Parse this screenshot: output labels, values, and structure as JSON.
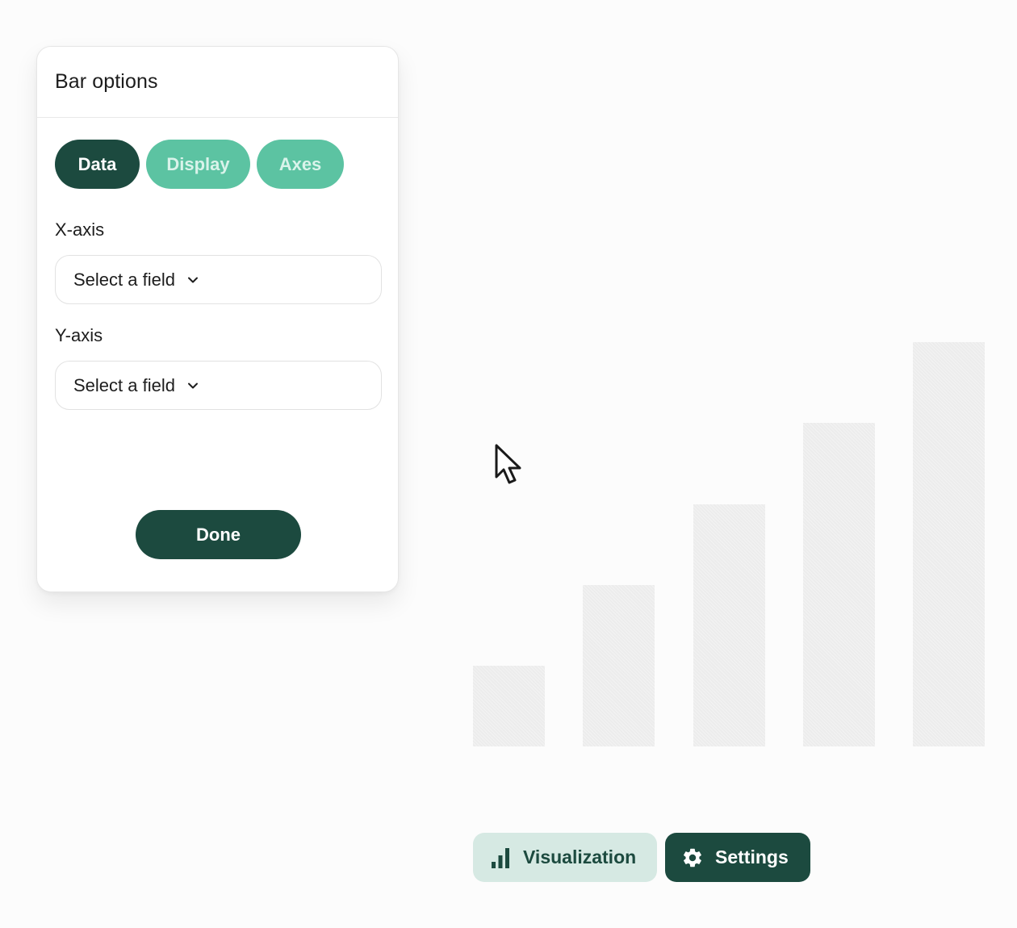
{
  "panel": {
    "title": "Bar options",
    "tabs": [
      {
        "label": "Data",
        "active": true
      },
      {
        "label": "Display",
        "active": false
      },
      {
        "label": "Axes",
        "active": false
      }
    ],
    "x_axis": {
      "label": "X-axis",
      "value": "Select a field"
    },
    "y_axis": {
      "label": "Y-axis",
      "value": "Select a field"
    },
    "done_label": "Done"
  },
  "chart_data": {
    "type": "bar",
    "values": [
      1,
      2,
      3,
      4,
      5
    ],
    "ylim": [
      0,
      8
    ]
  },
  "toolbar": {
    "visualization_label": "Visualization",
    "visualization_icon": "bar-chart-icon",
    "settings_label": "Settings",
    "settings_icon": "gear-icon"
  },
  "colors": {
    "primary": "#1c4a3f",
    "accent": "#5cc3a2",
    "accent_light": "#d6e9e3",
    "placeholder_bar": "#ececec"
  }
}
